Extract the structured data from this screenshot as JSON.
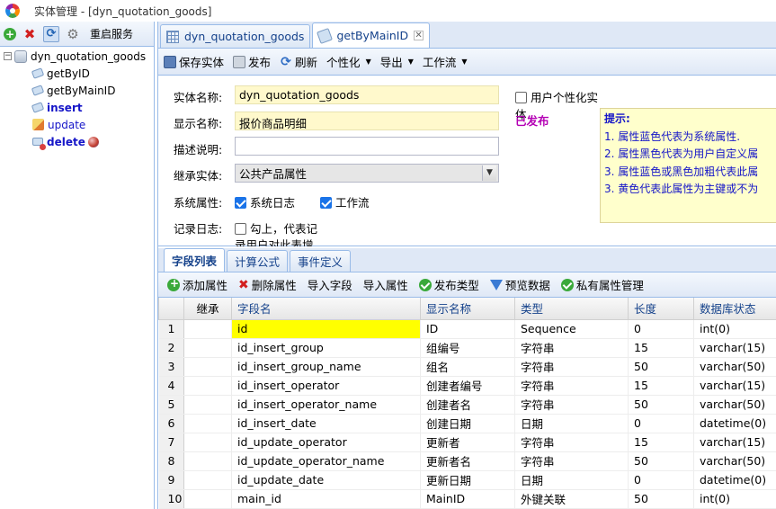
{
  "window": {
    "title": "实体管理 - [dyn_quotation_goods]"
  },
  "left_toolbar": {
    "restart_label": "重启服务"
  },
  "tree": {
    "root": "dyn_quotation_goods",
    "items": [
      {
        "label": "getByID"
      },
      {
        "label": "getByMainID"
      },
      {
        "label": "insert"
      },
      {
        "label": "update"
      },
      {
        "label": "delete"
      }
    ]
  },
  "doc_tabs": [
    {
      "label": "dyn_quotation_goods"
    },
    {
      "label": "getByMainID"
    }
  ],
  "main_toolbar": {
    "save": "保存实体",
    "publish": "发布",
    "refresh": "刷新",
    "personalize": "个性化",
    "export": "导出",
    "workflow": "工作流"
  },
  "form": {
    "entity_name_label": "实体名称:",
    "entity_name_value": "dyn_quotation_goods",
    "display_name_label": "显示名称:",
    "display_name_value": "报价商品明细",
    "description_label": "描述说明:",
    "description_value": "",
    "inherit_label": "继承实体:",
    "inherit_value": "公共产品属性",
    "system_attr_label": "系统属性:",
    "system_log_label": "系统日志",
    "workflow_label": "工作流",
    "record_log_label": "记录日志:",
    "record_log_text_1": "勾上，代表记",
    "record_log_text_2": "录用户对此表增",
    "user_personal_line1": "用户个性化实",
    "user_personal_line2": "体",
    "published_label": "已发布"
  },
  "tips": {
    "title": "提示:",
    "lines": [
      "1. 属性蓝色代表为系统属性.",
      "2. 属性黑色代表为用户自定义属",
      "3. 属性蓝色或黑色加粗代表此属",
      "3. 黄色代表此属性为主键或不为"
    ]
  },
  "sub_tabs": [
    {
      "label": "字段列表"
    },
    {
      "label": "计算公式"
    },
    {
      "label": "事件定义"
    }
  ],
  "grid_toolbar": {
    "add": "添加属性",
    "delete": "删除属性",
    "import_field": "导入字段",
    "import_attr": "导入属性",
    "publish_type": "发布类型",
    "preview": "预览数据",
    "private_attr": "私有属性管理"
  },
  "grid": {
    "headers": [
      "继承",
      "字段名",
      "显示名称",
      "类型",
      "长度",
      "数据库状态"
    ],
    "rows": [
      {
        "n": "1",
        "field": "id",
        "display": "ID",
        "type": "Sequence",
        "len": "0",
        "db": "int(0)"
      },
      {
        "n": "2",
        "field": "id_insert_group",
        "display": "组编号",
        "type": "字符串",
        "len": "15",
        "db": "varchar(15)"
      },
      {
        "n": "3",
        "field": "id_insert_group_name",
        "display": "组名",
        "type": "字符串",
        "len": "50",
        "db": "varchar(50)"
      },
      {
        "n": "4",
        "field": "id_insert_operator",
        "display": "创建者编号",
        "type": "字符串",
        "len": "15",
        "db": "varchar(15)"
      },
      {
        "n": "5",
        "field": "id_insert_operator_name",
        "display": "创建者名",
        "type": "字符串",
        "len": "50",
        "db": "varchar(50)"
      },
      {
        "n": "6",
        "field": "id_insert_date",
        "display": "创建日期",
        "type": "日期",
        "len": "0",
        "db": "datetime(0)"
      },
      {
        "n": "7",
        "field": "id_update_operator",
        "display": "更新者",
        "type": "字符串",
        "len": "15",
        "db": "varchar(15)"
      },
      {
        "n": "8",
        "field": "id_update_operator_name",
        "display": "更新者名",
        "type": "字符串",
        "len": "50",
        "db": "varchar(50)"
      },
      {
        "n": "9",
        "field": "id_update_date",
        "display": "更新日期",
        "type": "日期",
        "len": "0",
        "db": "datetime(0)"
      },
      {
        "n": "10",
        "field": "main_id",
        "display": "MainID",
        "type": "外键关联",
        "len": "50",
        "db": "int(0)"
      }
    ]
  }
}
